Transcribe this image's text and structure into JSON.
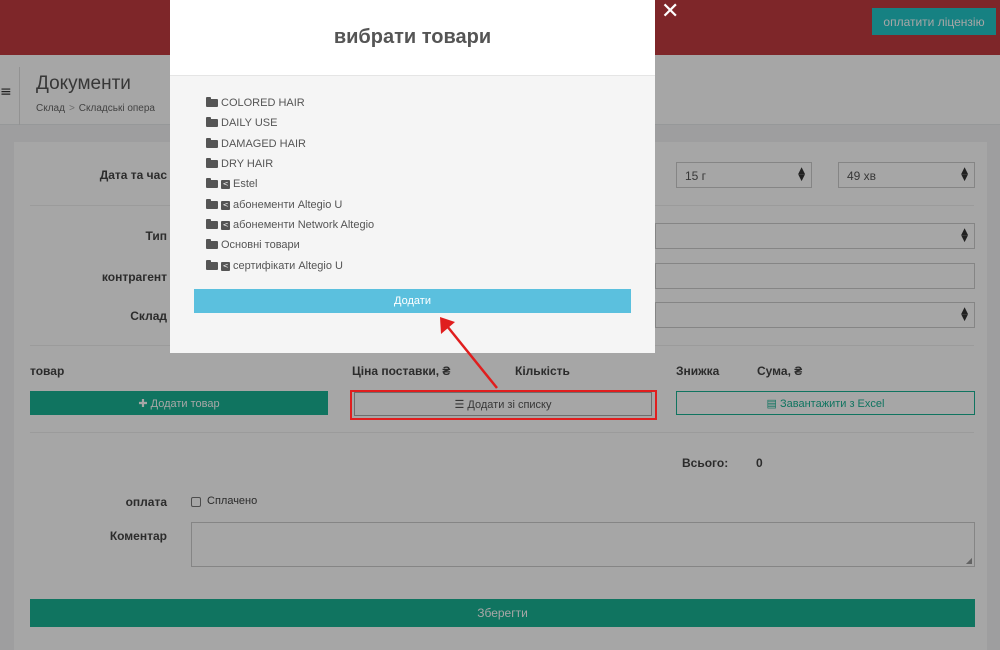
{
  "topbar": {
    "license_button": "оплатити ліцензію"
  },
  "header": {
    "menu_icon": "≡",
    "title": "Документи",
    "breadcrumb": {
      "item1": "Склад",
      "separator": ">",
      "item2": "Складські опера"
    }
  },
  "form": {
    "date_label": "Дата та час",
    "hour_value": "15 г",
    "minute_value": "49 хв",
    "type_label": "Тип",
    "contractor_label": "контрагент",
    "warehouse_label": "Склад"
  },
  "columns": {
    "product": "товар",
    "price": "Ціна поставки, ₴",
    "quantity": "Кількість",
    "discount": "Знижка",
    "sum": "Сума, ₴"
  },
  "buttons": {
    "add_product": "Додати товар",
    "add_from_list": "Додати зі списку",
    "upload_excel": "Завантажити з Excel",
    "save": "Зберегти"
  },
  "totals": {
    "label": "Всього:",
    "value": "0"
  },
  "payment": {
    "label": "оплата",
    "checkbox_label": "Сплачено"
  },
  "comment": {
    "label": "Коментар"
  },
  "modal": {
    "title": "вибрати товари",
    "close": "✕",
    "items": [
      {
        "label": "COLORED HAIR",
        "shared": false
      },
      {
        "label": "DAILY USE",
        "shared": false
      },
      {
        "label": "DAMAGED HAIR",
        "shared": false
      },
      {
        "label": "DRY HAIR",
        "shared": false
      },
      {
        "label": "Estel",
        "shared": true
      },
      {
        "label": "абонементи Altegio U",
        "shared": true
      },
      {
        "label": "абонементи Network Altegio",
        "shared": true
      },
      {
        "label": "Основні товари",
        "shared": false
      },
      {
        "label": "сертифікати Altegio U",
        "shared": true
      }
    ],
    "add_button": "Додати"
  },
  "colors": {
    "topbar": "#c23b3f",
    "primary": "#1ab394",
    "info": "#5bc0de",
    "annotation": "#e01e1e"
  }
}
